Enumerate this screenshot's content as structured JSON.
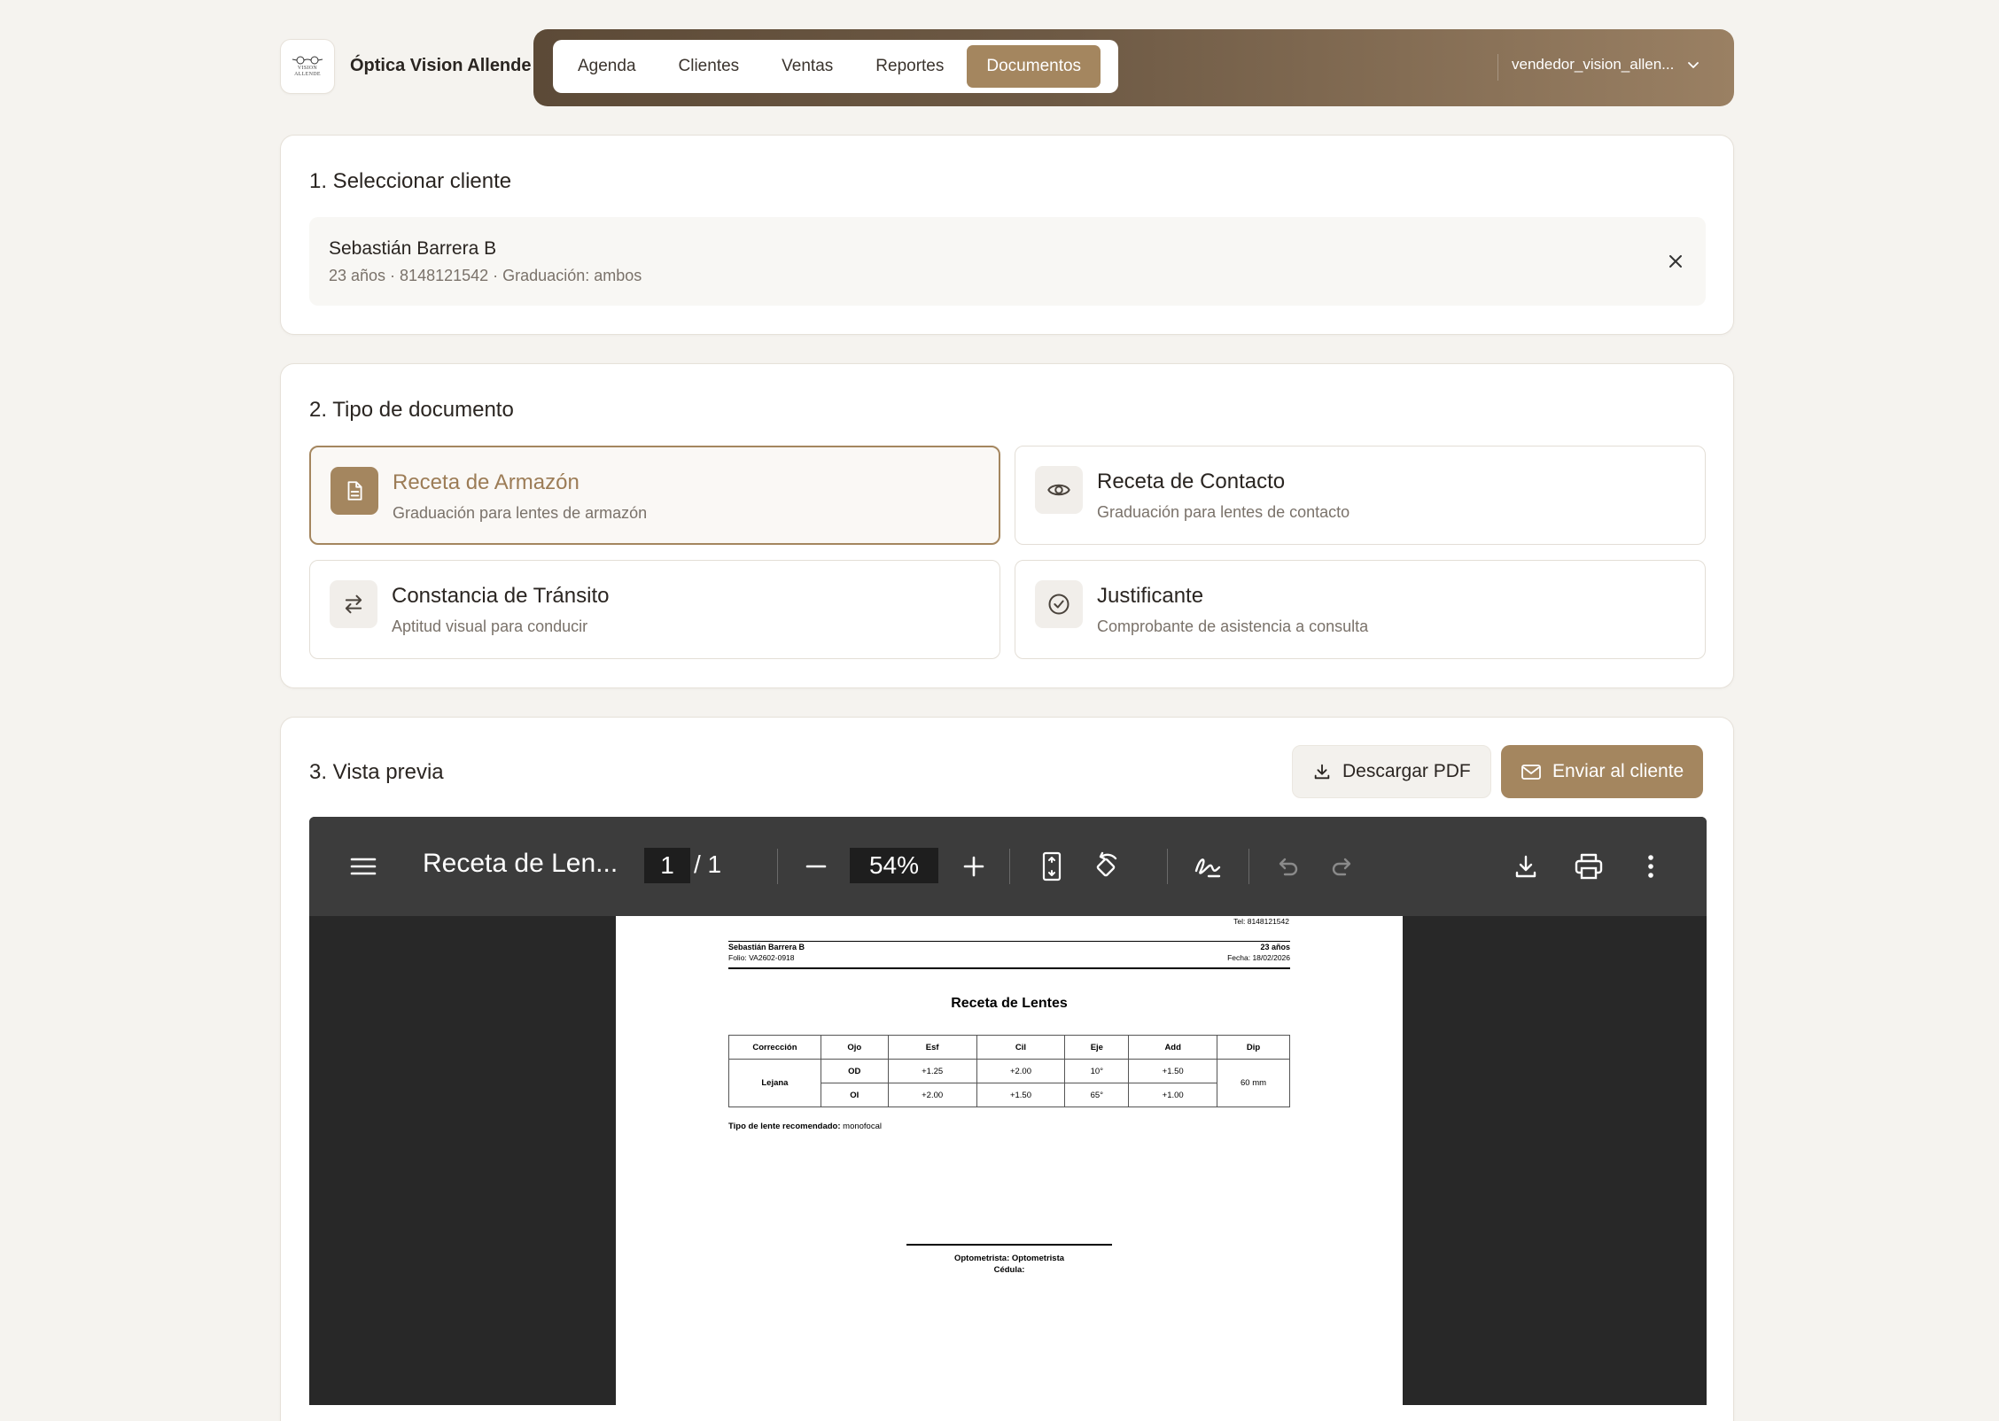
{
  "brand": {
    "name": "Óptica Vision Allende",
    "logo_text": "VISION ALLENDE"
  },
  "nav": {
    "tabs": [
      {
        "label": "Agenda"
      },
      {
        "label": "Clientes"
      },
      {
        "label": "Ventas"
      },
      {
        "label": "Reportes"
      },
      {
        "label": "Documentos"
      }
    ],
    "active_tab": "Documentos",
    "user": "vendedor_vision_allen..."
  },
  "step1": {
    "title": "1. Seleccionar cliente",
    "client_name": "Sebastián Barrera B",
    "client_meta": "23 años · 8148121542 · Graduación: ambos"
  },
  "step2": {
    "title": "2. Tipo de documento",
    "options": [
      {
        "title": "Receta de Armazón",
        "subtitle": "Graduación para lentes de armazón",
        "icon": "document-icon",
        "selected": true
      },
      {
        "title": "Receta de Contacto",
        "subtitle": "Graduación para lentes de contacto",
        "icon": "eye-icon",
        "selected": false
      },
      {
        "title": "Constancia de Tránsito",
        "subtitle": "Aptitud visual para conducir",
        "icon": "arrows-exchange-icon",
        "selected": false
      },
      {
        "title": "Justificante",
        "subtitle": "Comprobante de asistencia a consulta",
        "icon": "check-circle-icon",
        "selected": false
      }
    ]
  },
  "step3": {
    "title": "3. Vista previa",
    "download_label": "Descargar PDF",
    "send_label": "Enviar al cliente"
  },
  "viewer": {
    "doc_title": "Receta de Len...",
    "page_current": "1",
    "page_total": "/  1",
    "zoom": "54%"
  },
  "pdf": {
    "tel": "Tel: 8148121542",
    "patient": "Sebastián Barrera B",
    "age": "23 años",
    "folio": "Folio: VA2602-0918",
    "fecha": "Fecha: 18/02/2026",
    "heading": "Receta de Lentes",
    "table_headers": [
      "Corrección",
      "Ojo",
      "Esf",
      "Cil",
      "Eje",
      "Add",
      "Dip"
    ],
    "correccion": "Lejana",
    "rows": [
      {
        "ojo": "OD",
        "esf": "+1.25",
        "cil": "+2.00",
        "eje": "10°",
        "add": "+1.50"
      },
      {
        "ojo": "OI",
        "esf": "+2.00",
        "cil": "+1.50",
        "eje": "65°",
        "add": "+1.00"
      }
    ],
    "dip": "60 mm",
    "lens_label": "Tipo de lente recomendado:",
    "lens_value": "monofocal",
    "signer": "Optometrista: Optometrista",
    "cedula": "Cédula:"
  },
  "colors": {
    "accent": "#a4865f",
    "nav_dark": "#5c4a37",
    "background": "#f5f3ef",
    "viewer_bg": "#282828",
    "viewer_toolbar": "#3c3c3c"
  }
}
